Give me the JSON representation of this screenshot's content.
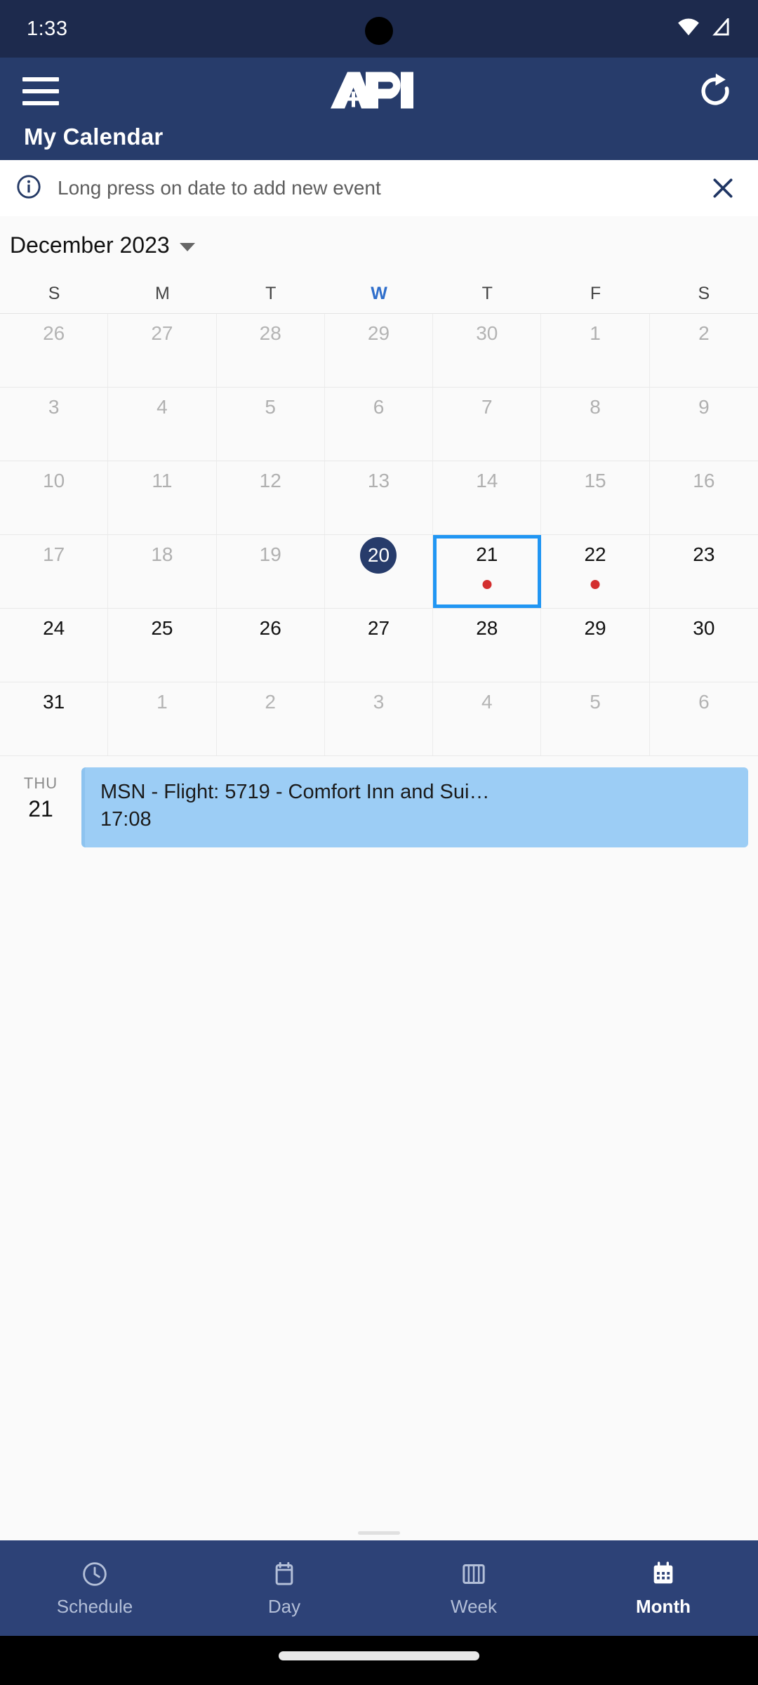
{
  "status_bar": {
    "time": "1:33",
    "icons": [
      "wifi-icon",
      "signal-icon"
    ]
  },
  "app_bar": {
    "menu_icon": "hamburger-menu-icon",
    "logo_text": "API",
    "logo_plus": "+",
    "refresh_icon": "refresh-icon",
    "title": "My Calendar",
    "background_color": "#273c6b"
  },
  "banner": {
    "icon": "info-icon",
    "text": "Long press on date to add new event",
    "close_icon": "close-icon"
  },
  "month_selector": {
    "label": "December 2023",
    "caret_icon": "chevron-down-icon"
  },
  "calendar": {
    "weekday_headers": [
      "S",
      "M",
      "T",
      "W",
      "T",
      "F",
      "S"
    ],
    "today_column_index": 3,
    "today_highlight_color": "#273c6b",
    "selected_border_color": "#2196f3",
    "event_dot_color": "#d32f2f",
    "rows": [
      [
        {
          "day": "26",
          "state": "muted"
        },
        {
          "day": "27",
          "state": "muted"
        },
        {
          "day": "28",
          "state": "muted"
        },
        {
          "day": "29",
          "state": "muted"
        },
        {
          "day": "30",
          "state": "muted"
        },
        {
          "day": "1",
          "state": "past"
        },
        {
          "day": "2",
          "state": "past"
        }
      ],
      [
        {
          "day": "3",
          "state": "past"
        },
        {
          "day": "4",
          "state": "past"
        },
        {
          "day": "5",
          "state": "past"
        },
        {
          "day": "6",
          "state": "past"
        },
        {
          "day": "7",
          "state": "past"
        },
        {
          "day": "8",
          "state": "past"
        },
        {
          "day": "9",
          "state": "past"
        }
      ],
      [
        {
          "day": "10",
          "state": "past"
        },
        {
          "day": "11",
          "state": "past"
        },
        {
          "day": "12",
          "state": "past"
        },
        {
          "day": "13",
          "state": "past"
        },
        {
          "day": "14",
          "state": "past"
        },
        {
          "day": "15",
          "state": "past"
        },
        {
          "day": "16",
          "state": "past"
        }
      ],
      [
        {
          "day": "17",
          "state": "past"
        },
        {
          "day": "18",
          "state": "past"
        },
        {
          "day": "19",
          "state": "past"
        },
        {
          "day": "20",
          "state": "today"
        },
        {
          "day": "21",
          "state": "selected",
          "has_event": true
        },
        {
          "day": "22",
          "state": "normal",
          "has_event": true
        },
        {
          "day": "23",
          "state": "normal"
        }
      ],
      [
        {
          "day": "24",
          "state": "normal"
        },
        {
          "day": "25",
          "state": "normal"
        },
        {
          "day": "26",
          "state": "normal"
        },
        {
          "day": "27",
          "state": "normal"
        },
        {
          "day": "28",
          "state": "normal"
        },
        {
          "day": "29",
          "state": "normal"
        },
        {
          "day": "30",
          "state": "normal"
        }
      ],
      [
        {
          "day": "31",
          "state": "normal"
        },
        {
          "day": "1",
          "state": "muted"
        },
        {
          "day": "2",
          "state": "muted"
        },
        {
          "day": "3",
          "state": "muted"
        },
        {
          "day": "4",
          "state": "muted"
        },
        {
          "day": "5",
          "state": "muted"
        },
        {
          "day": "6",
          "state": "muted"
        }
      ]
    ]
  },
  "agenda": {
    "events": [
      {
        "dow": "THU",
        "day": "21",
        "title": "MSN - Flight: 5719 - Comfort Inn and Sui…",
        "time": "17:08",
        "color": "#9ccdf5"
      }
    ]
  },
  "bottom_nav": {
    "items": [
      {
        "label": "Schedule",
        "icon": "clock-icon",
        "active": false
      },
      {
        "label": "Day",
        "icon": "day-view-icon",
        "active": false
      },
      {
        "label": "Week",
        "icon": "week-view-icon",
        "active": false
      },
      {
        "label": "Month",
        "icon": "month-calendar-icon",
        "active": true
      }
    ],
    "background_color": "#2d4277"
  }
}
